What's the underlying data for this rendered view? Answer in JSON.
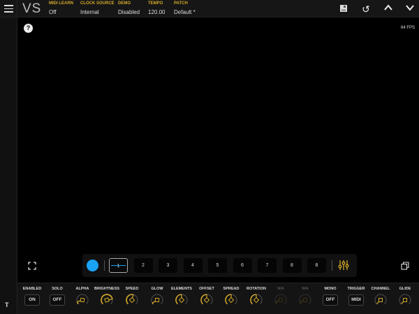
{
  "header": {
    "logo": "VS",
    "fields": [
      {
        "label": "MIDI LEARN",
        "value": "Off"
      },
      {
        "label": "CLOCK SOURCE",
        "value": "Internal"
      },
      {
        "label": "DEMO",
        "value": "Disabled"
      },
      {
        "label": "TEMPO",
        "value": "120.00"
      },
      {
        "label": "PATCH",
        "value": "Default *"
      }
    ]
  },
  "viewport": {
    "help": "?",
    "fps": "64 FPS"
  },
  "slots": {
    "color": "#1aa3f5",
    "items": [
      "1",
      "2",
      "3",
      "4",
      "5",
      "6",
      "7",
      "8",
      "8"
    ],
    "selected": 0
  },
  "sidebar": {
    "bottom_icon": "T"
  },
  "controls": [
    {
      "label": "ENABLED",
      "type": "button",
      "value": "ON"
    },
    {
      "label": "SOLO",
      "type": "button",
      "value": "OFF"
    },
    {
      "label": "ALPHA",
      "type": "knob",
      "level": 0.1
    },
    {
      "label": "BRIGHTNESS",
      "type": "knob",
      "level": 0.8
    },
    {
      "label": "SPEED",
      "type": "knob",
      "level": 0.55
    },
    {
      "label": "GLOW",
      "type": "knob",
      "level": 0.05
    },
    {
      "label": "ELEMENTS",
      "type": "knob",
      "level": 0.5
    },
    {
      "label": "OFFSET",
      "type": "knob",
      "level": 0.5
    },
    {
      "label": "SPREAD",
      "type": "knob",
      "level": 0.5
    },
    {
      "label": "ROTATION",
      "type": "knob",
      "level": 0.5
    },
    {
      "label": "N/A",
      "type": "knob",
      "level": 0.1,
      "disabled": true
    },
    {
      "label": "N/A",
      "type": "knob",
      "level": 0.1,
      "disabled": true
    },
    {
      "label": "MONO",
      "type": "button",
      "value": "OFF"
    },
    {
      "label": "TRIGGER",
      "type": "button",
      "value": "MIDI"
    },
    {
      "label": "CHANNEL",
      "type": "knob",
      "level": 0.0
    },
    {
      "label": "GLIDE",
      "type": "knob",
      "level": 0.0
    }
  ],
  "colors": {
    "accent": "#d4a92a",
    "selection": "#1aa3f5"
  }
}
